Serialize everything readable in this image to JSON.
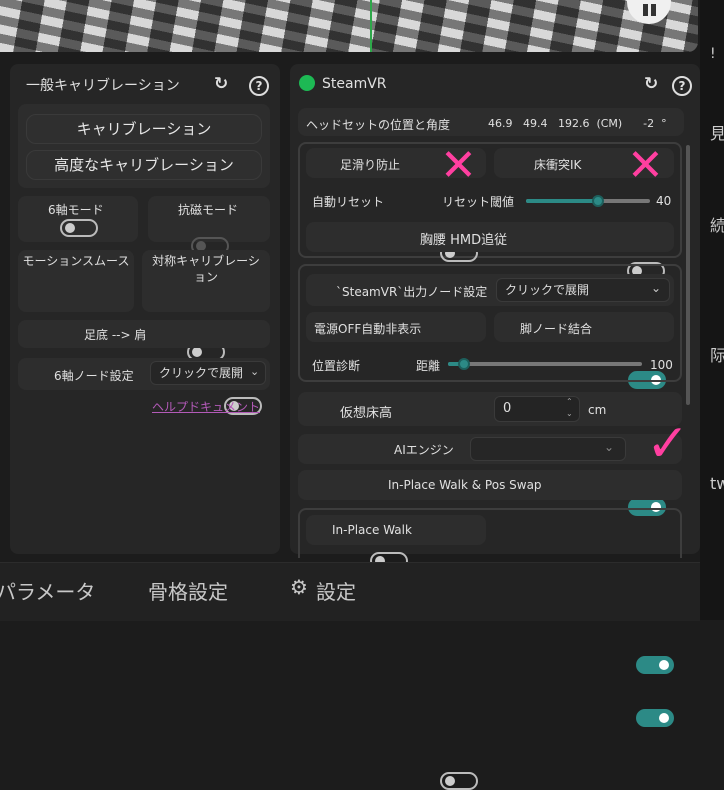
{
  "left_panel": {
    "title": "一般キャリブレーション",
    "calibration_btn": "キャリブレーション",
    "advanced_btn": "高度なキャリブレーション",
    "six_axis": "6軸モード",
    "anti_mag": "抗磁モード",
    "motion_smooth": "モーションスムース",
    "symmetric_cal": "対称キャリブレーション",
    "sole_shoulder": "足底 --> 肩",
    "six_axis_node": "6軸ノード設定",
    "six_axis_node_value": "クリックで展開",
    "help_link": "ヘルプドキュメント"
  },
  "right_panel": {
    "title": "SteamVR",
    "headset_label": "ヘッドセットの位置と角度",
    "headset_values": "46.9   49.4   192.6  (CM)      -2  °",
    "anti_slip": "足滑り防止",
    "floor_ik": "床衝突IK",
    "auto_reset": "自動リセット",
    "reset_threshold": "リセット閾値",
    "reset_threshold_value": "40",
    "reset_threshold_fraction": 0.58,
    "chest_waist_hmd": "胸腰 HMD追従",
    "output_node": "`SteamVR`出力ノード設定",
    "output_node_value": "クリックで展開",
    "power_off": "電源OFF自動非表示",
    "leg_node": "脚ノード結合",
    "pos_diag": "位置診断",
    "distance": "距離",
    "distance_value": "100",
    "distance_fraction": 0.08,
    "virtual_floor": "仮想床高",
    "virtual_floor_value": "0",
    "virtual_floor_unit": "cm",
    "ai_engine": "AIエンジン",
    "inplace_swap": "In-Place Walk & Pos Swap",
    "inplace_walk": "In-Place Walk"
  },
  "bottom_tabs": {
    "params": "パラメータ",
    "skeleton": "骨格設定",
    "settings": "設定"
  },
  "right_edge": [
    "見",
    "続",
    "际",
    "tw"
  ],
  "colors": {
    "accent": "#2c8a86",
    "status_green": "#1db954",
    "annotation": "#ff3fa0"
  }
}
